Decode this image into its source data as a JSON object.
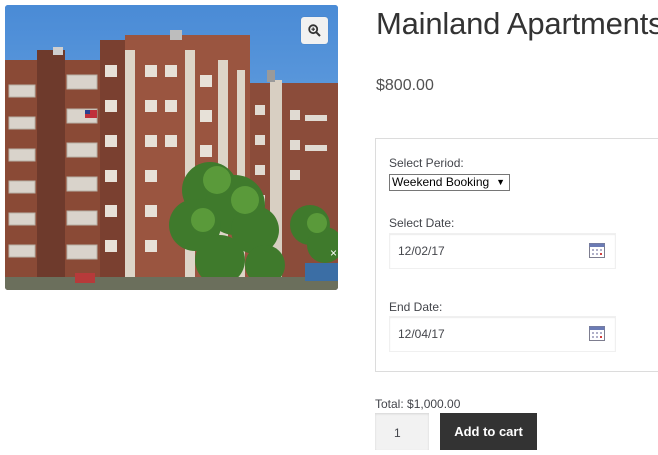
{
  "product": {
    "title": "Mainland Apartments",
    "price": "$800.00",
    "image_alt": "apartment building photo"
  },
  "booking": {
    "period_label": "Select Period:",
    "period_value": "Weekend Booking",
    "start_label": "Select Date:",
    "start_value": "12/02/17",
    "end_label": "End Date:",
    "end_value": "12/04/17"
  },
  "cart": {
    "total": "Total: $1,000.00",
    "quantity": "1",
    "add_label": "Add to cart"
  },
  "icons": {
    "zoom": "magnifier-zoom-icon",
    "calendar": "calendar-icon",
    "close": "close-icon",
    "dropdown": "dropdown-arrow-icon"
  },
  "colors": {
    "button": "#333333",
    "sky": "#5b96d8",
    "brick": "#8a4a36"
  }
}
